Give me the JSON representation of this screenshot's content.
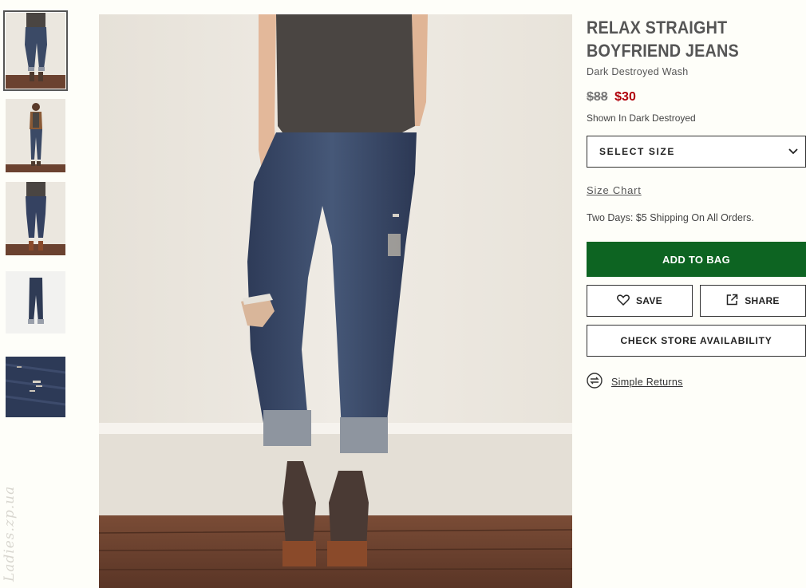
{
  "product": {
    "title": "RELAX STRAIGHT BOYFRIEND JEANS",
    "subtitle": "Dark Destroyed Wash",
    "old_price": "$88",
    "new_price": "$30",
    "shown_in": "Shown In Dark Destroyed"
  },
  "size_select": {
    "label": "SELECT SIZE",
    "icon": "chevron-down-icon"
  },
  "size_chart_label": "Size Chart",
  "shipping_text": "Two Days: $5 Shipping On All Orders.",
  "buttons": {
    "add_to_bag": "ADD TO BAG",
    "save": "SAVE",
    "share": "SHARE",
    "check_store": "CHECK STORE AVAILABILITY"
  },
  "returns_label": "Simple Returns",
  "watermark": "Ladies.zp.ua",
  "colors": {
    "accent_green": "#0d6422",
    "sale_red": "#b0000b",
    "denim": "#3b4a66",
    "top": "#4a4542",
    "wall": "#ebe7df",
    "floor": "#6b4230"
  },
  "thumbnails": [
    {
      "name": "thumb-front-view",
      "active": true
    },
    {
      "name": "thumb-full-body"
    },
    {
      "name": "thumb-back-view"
    },
    {
      "name": "thumb-flat-lay"
    },
    {
      "name": "thumb-detail-closeup"
    }
  ]
}
